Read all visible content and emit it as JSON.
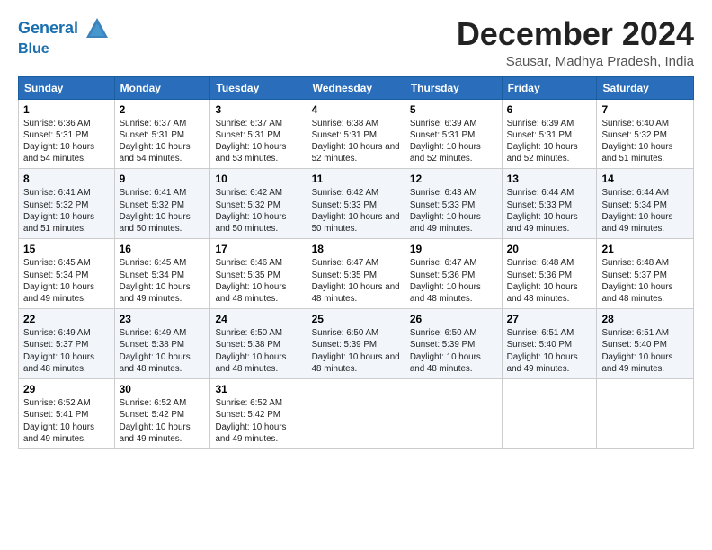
{
  "logo": {
    "line1": "General",
    "line2": "Blue"
  },
  "title": "December 2024",
  "location": "Sausar, Madhya Pradesh, India",
  "weekdays": [
    "Sunday",
    "Monday",
    "Tuesday",
    "Wednesday",
    "Thursday",
    "Friday",
    "Saturday"
  ],
  "weeks": [
    [
      {
        "day": "1",
        "sunrise": "6:36 AM",
        "sunset": "5:31 PM",
        "daylight": "10 hours and 54 minutes."
      },
      {
        "day": "2",
        "sunrise": "6:37 AM",
        "sunset": "5:31 PM",
        "daylight": "10 hours and 54 minutes."
      },
      {
        "day": "3",
        "sunrise": "6:37 AM",
        "sunset": "5:31 PM",
        "daylight": "10 hours and 53 minutes."
      },
      {
        "day": "4",
        "sunrise": "6:38 AM",
        "sunset": "5:31 PM",
        "daylight": "10 hours and 52 minutes."
      },
      {
        "day": "5",
        "sunrise": "6:39 AM",
        "sunset": "5:31 PM",
        "daylight": "10 hours and 52 minutes."
      },
      {
        "day": "6",
        "sunrise": "6:39 AM",
        "sunset": "5:31 PM",
        "daylight": "10 hours and 52 minutes."
      },
      {
        "day": "7",
        "sunrise": "6:40 AM",
        "sunset": "5:32 PM",
        "daylight": "10 hours and 51 minutes."
      }
    ],
    [
      {
        "day": "8",
        "sunrise": "6:41 AM",
        "sunset": "5:32 PM",
        "daylight": "10 hours and 51 minutes."
      },
      {
        "day": "9",
        "sunrise": "6:41 AM",
        "sunset": "5:32 PM",
        "daylight": "10 hours and 50 minutes."
      },
      {
        "day": "10",
        "sunrise": "6:42 AM",
        "sunset": "5:32 PM",
        "daylight": "10 hours and 50 minutes."
      },
      {
        "day": "11",
        "sunrise": "6:42 AM",
        "sunset": "5:33 PM",
        "daylight": "10 hours and 50 minutes."
      },
      {
        "day": "12",
        "sunrise": "6:43 AM",
        "sunset": "5:33 PM",
        "daylight": "10 hours and 49 minutes."
      },
      {
        "day": "13",
        "sunrise": "6:44 AM",
        "sunset": "5:33 PM",
        "daylight": "10 hours and 49 minutes."
      },
      {
        "day": "14",
        "sunrise": "6:44 AM",
        "sunset": "5:34 PM",
        "daylight": "10 hours and 49 minutes."
      }
    ],
    [
      {
        "day": "15",
        "sunrise": "6:45 AM",
        "sunset": "5:34 PM",
        "daylight": "10 hours and 49 minutes."
      },
      {
        "day": "16",
        "sunrise": "6:45 AM",
        "sunset": "5:34 PM",
        "daylight": "10 hours and 49 minutes."
      },
      {
        "day": "17",
        "sunrise": "6:46 AM",
        "sunset": "5:35 PM",
        "daylight": "10 hours and 48 minutes."
      },
      {
        "day": "18",
        "sunrise": "6:47 AM",
        "sunset": "5:35 PM",
        "daylight": "10 hours and 48 minutes."
      },
      {
        "day": "19",
        "sunrise": "6:47 AM",
        "sunset": "5:36 PM",
        "daylight": "10 hours and 48 minutes."
      },
      {
        "day": "20",
        "sunrise": "6:48 AM",
        "sunset": "5:36 PM",
        "daylight": "10 hours and 48 minutes."
      },
      {
        "day": "21",
        "sunrise": "6:48 AM",
        "sunset": "5:37 PM",
        "daylight": "10 hours and 48 minutes."
      }
    ],
    [
      {
        "day": "22",
        "sunrise": "6:49 AM",
        "sunset": "5:37 PM",
        "daylight": "10 hours and 48 minutes."
      },
      {
        "day": "23",
        "sunrise": "6:49 AM",
        "sunset": "5:38 PM",
        "daylight": "10 hours and 48 minutes."
      },
      {
        "day": "24",
        "sunrise": "6:50 AM",
        "sunset": "5:38 PM",
        "daylight": "10 hours and 48 minutes."
      },
      {
        "day": "25",
        "sunrise": "6:50 AM",
        "sunset": "5:39 PM",
        "daylight": "10 hours and 48 minutes."
      },
      {
        "day": "26",
        "sunrise": "6:50 AM",
        "sunset": "5:39 PM",
        "daylight": "10 hours and 48 minutes."
      },
      {
        "day": "27",
        "sunrise": "6:51 AM",
        "sunset": "5:40 PM",
        "daylight": "10 hours and 49 minutes."
      },
      {
        "day": "28",
        "sunrise": "6:51 AM",
        "sunset": "5:40 PM",
        "daylight": "10 hours and 49 minutes."
      }
    ],
    [
      {
        "day": "29",
        "sunrise": "6:52 AM",
        "sunset": "5:41 PM",
        "daylight": "10 hours and 49 minutes."
      },
      {
        "day": "30",
        "sunrise": "6:52 AM",
        "sunset": "5:42 PM",
        "daylight": "10 hours and 49 minutes."
      },
      {
        "day": "31",
        "sunrise": "6:52 AM",
        "sunset": "5:42 PM",
        "daylight": "10 hours and 49 minutes."
      },
      null,
      null,
      null,
      null
    ]
  ]
}
